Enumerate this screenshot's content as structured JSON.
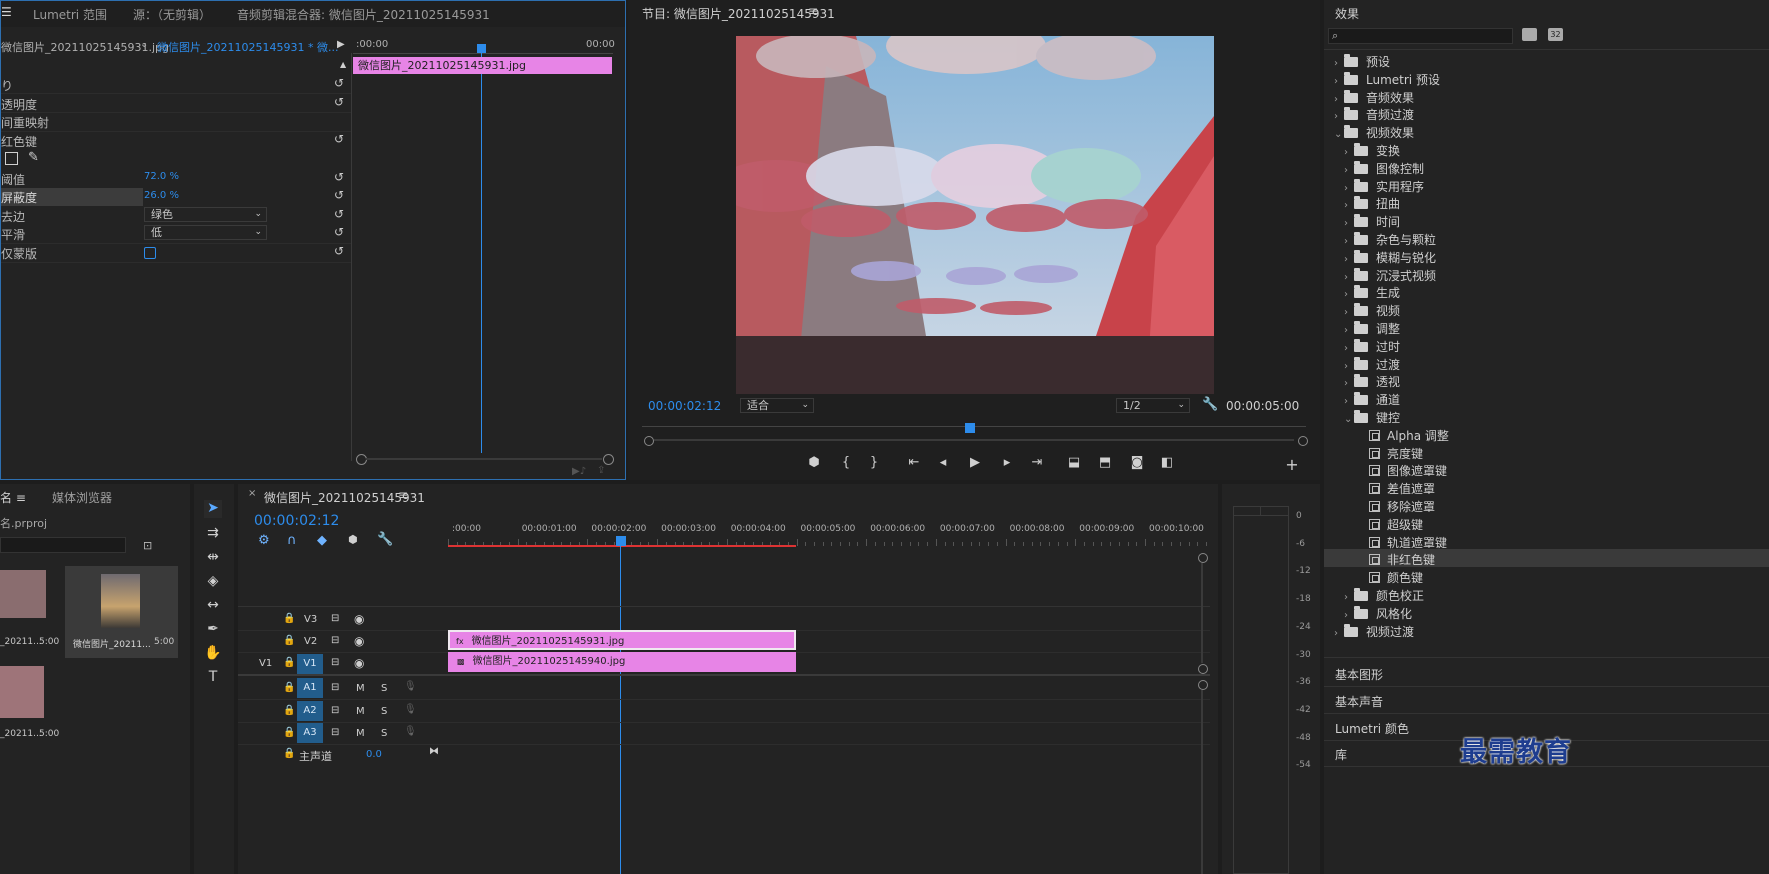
{
  "effect_controls": {
    "tabs": [
      "Lumetri 范围",
      "源：（无剪辑）",
      "音频剪辑混合器: 微信图片_20211025145931"
    ],
    "source_clip": "微信图片_20211025145931.jpg",
    "seq_clip": "微信图片_20211025145931 * 微...",
    "time_start": ":00:00",
    "time_end": "00:00",
    "clip_label": "微信图片_20211025145931.jpg",
    "properties": [
      {
        "label": "り"
      },
      {
        "label": "透明度"
      },
      {
        "label": "间重映射"
      },
      {
        "label": "红色键"
      },
      {
        "label": ""
      },
      {
        "label": "阈值",
        "value": "72.0 %"
      },
      {
        "label": "屏蔽度",
        "value": "26.0 %"
      },
      {
        "label": "去边",
        "value": "绿色"
      },
      {
        "label": "平滑",
        "value": "低"
      },
      {
        "label": "仅蒙版"
      }
    ]
  },
  "program_monitor": {
    "title": "节目: 微信图片_20211025145931",
    "timecode": "00:00:02:12",
    "fit": "适合",
    "resolution": "1/2",
    "duration": "00:00:05:00",
    "playhead": 0.5
  },
  "effects_panel": {
    "title": "效果",
    "items": [
      {
        "label": "预设",
        "level": 0
      },
      {
        "label": "Lumetri 预设",
        "level": 0
      },
      {
        "label": "音频效果",
        "level": 0
      },
      {
        "label": "音频过渡",
        "level": 0
      },
      {
        "label": "视频效果",
        "level": 0,
        "open": true
      },
      {
        "label": "变换",
        "level": 1
      },
      {
        "label": "图像控制",
        "level": 1
      },
      {
        "label": "实用程序",
        "level": 1
      },
      {
        "label": "扭曲",
        "level": 1
      },
      {
        "label": "时间",
        "level": 1
      },
      {
        "label": "杂色与颗粒",
        "level": 1
      },
      {
        "label": "模糊与锐化",
        "level": 1
      },
      {
        "label": "沉浸式视频",
        "level": 1
      },
      {
        "label": "生成",
        "level": 1
      },
      {
        "label": "视频",
        "level": 1
      },
      {
        "label": "调整",
        "level": 1
      },
      {
        "label": "过时",
        "level": 1
      },
      {
        "label": "过渡",
        "level": 1
      },
      {
        "label": "透视",
        "level": 1
      },
      {
        "label": "通道",
        "level": 1
      },
      {
        "label": "键控",
        "level": 1,
        "open": true
      },
      {
        "label": "Alpha 调整",
        "level": 2
      },
      {
        "label": "亮度键",
        "level": 2
      },
      {
        "label": "图像遮罩键",
        "level": 2
      },
      {
        "label": "差值遮罩",
        "level": 2
      },
      {
        "label": "移除遮罩",
        "level": 2
      },
      {
        "label": "超级键",
        "level": 2
      },
      {
        "label": "轨道遮罩键",
        "level": 2
      },
      {
        "label": "非红色键",
        "level": 2,
        "selected": true
      },
      {
        "label": "颜色键",
        "level": 2
      },
      {
        "label": "颜色校正",
        "level": 1
      },
      {
        "label": "风格化",
        "level": 1
      },
      {
        "label": "视频过渡",
        "level": 0
      }
    ],
    "bottom_panels": [
      "基本图形",
      "基本声音",
      "Lumetri 颜色",
      "库"
    ]
  },
  "project": {
    "tabs": [
      "名",
      "媒体浏览器"
    ],
    "file": "名.prproj",
    "items": [
      {
        "name": "_20211...",
        "duration": "5:00"
      },
      {
        "name": "微信图片_20211...",
        "duration": "5:00"
      },
      {
        "name": "_20211...",
        "duration": "5:00"
      }
    ]
  },
  "timeline": {
    "title": "微信图片_20211025145931",
    "timecode": "00:00:02:12",
    "ruler": [
      ":00:00",
      "00:00:01:00",
      "00:00:02:00",
      "00:00:03:00",
      "00:00:04:00",
      "00:00:05:00",
      "00:00:06:00",
      "00:00:07:00",
      "00:00:08:00",
      "00:00:09:00",
      "00:00:10:00",
      "0"
    ],
    "video_tracks": [
      "V3",
      "V2",
      "V1"
    ],
    "audio_tracks": [
      "A1",
      "A2",
      "A3"
    ],
    "source_patch": "V1",
    "master": "主声道",
    "master_value": "0.0",
    "clips": [
      {
        "name": "微信图片_20211025145931.jpg",
        "track": "V2"
      },
      {
        "name": "微信图片_20211025145940.jpg",
        "track": "V1"
      }
    ],
    "audio_btns": [
      "M",
      "S"
    ]
  },
  "meter_labels": [
    "0",
    "-6",
    "-12",
    "-18",
    "-24",
    "-30",
    "-36",
    "-42",
    "-48",
    "-54"
  ],
  "watermark": "最需教育",
  "colors": {
    "accent": "#2d8ceb",
    "clip": "#e784e6",
    "selected_row": "#3a3a3a"
  }
}
